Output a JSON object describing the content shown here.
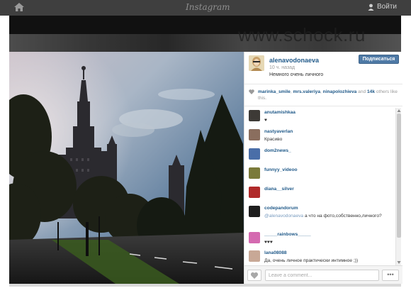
{
  "topbar": {
    "brand": "Instagram",
    "login_label": "Войти"
  },
  "watermark": "www.schock.ru",
  "post": {
    "owner": "alenavodonaeva",
    "time": "10 ч. назад",
    "caption": "Немного очень личного ",
    "follow_label": "Подписаться",
    "likes": {
      "names": [
        "marinka_smile",
        "mrs.valeriya",
        "ninapolozhieva"
      ],
      "and": "and",
      "count": "14k",
      "suffix": "others like this."
    }
  },
  "comments": [
    {
      "user": "anutamishkaa",
      "text": "♥"
    },
    {
      "user": "nastyaverlan",
      "text": "Красиво"
    },
    {
      "user": "dom2news_",
      "text": ""
    },
    {
      "user": "funnyy_videoo",
      "text": ""
    },
    {
      "user": "diana__silver",
      "text": ""
    },
    {
      "user": "codepandorum",
      "mention": "@alenavodonaeva",
      "text": "а что на фото,собственно,личного?"
    },
    {
      "user": "_____rainbows_____",
      "text": "♥♥♥"
    },
    {
      "user": "lana08088",
      "text": "Да, очень личное  практически интимное ;))"
    }
  ],
  "comment_bar": {
    "placeholder": "Leave a comment...",
    "more_label": "•••"
  },
  "colors": {
    "topbar": "#3f3f3f",
    "link": "#225b8a",
    "follow": "#4f7aa6"
  }
}
